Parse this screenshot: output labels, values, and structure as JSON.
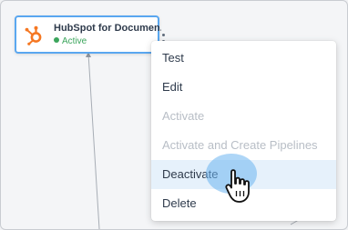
{
  "node": {
    "icon": "hubspot-icon",
    "title": "HubSpot for Documen...",
    "status": "Active",
    "status_color": "#3ba55c",
    "more_icon": "more-vertical-icon"
  },
  "context_menu": {
    "items": [
      {
        "label": "Test",
        "enabled": true
      },
      {
        "label": "Edit",
        "enabled": true
      },
      {
        "label": "Activate",
        "enabled": false
      },
      {
        "label": "Activate and Create Pipelines",
        "enabled": false
      },
      {
        "label": "Deactivate",
        "enabled": true,
        "hovered": true
      },
      {
        "label": "Delete",
        "enabled": true
      }
    ]
  },
  "cursor": {
    "icon": "hand-pointer-icon"
  },
  "colors": {
    "accent": "#5aa7f0",
    "hover_bg": "#e6f1fb",
    "disabled_text": "#b8bec6",
    "hubspot_orange": "#f57722"
  }
}
